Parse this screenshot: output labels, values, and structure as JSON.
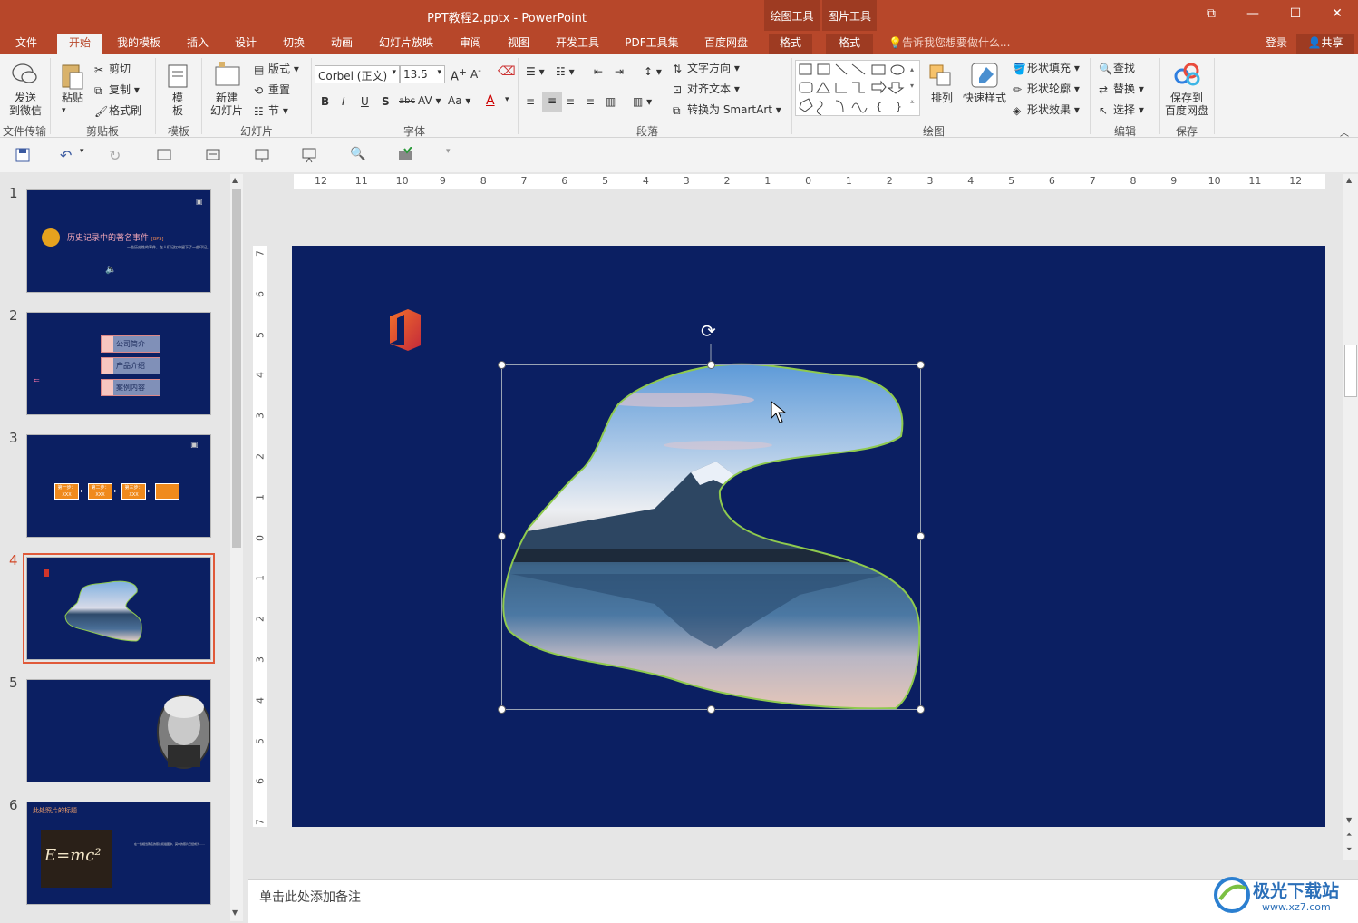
{
  "title": "PPT教程2.pptx - PowerPoint",
  "contextual": [
    {
      "group": "绘图工具",
      "tab": "格式"
    },
    {
      "group": "图片工具",
      "tab": "格式"
    }
  ],
  "window_buttons": {
    "restore_ribbon": "⧉",
    "minimize": "—",
    "maximize": "☐",
    "close": "✕"
  },
  "tabs": [
    "文件",
    "开始",
    "我的模板",
    "插入",
    "设计",
    "切换",
    "动画",
    "幻灯片放映",
    "审阅",
    "视图",
    "开发工具",
    "PDF工具集",
    "百度网盘"
  ],
  "active_tab": "开始",
  "tell_me": "告诉我您想要做什么...",
  "login": "登录",
  "share": "共享",
  "ribbon": {
    "send_wechat": "发送\n到微信",
    "file_transfer": "文件传输",
    "paste": "粘贴",
    "cut": "剪切",
    "copy": "复制",
    "format_painter": "格式刷",
    "clipboard": "剪贴板",
    "template": "模\n板",
    "template_grp": "模板",
    "new_slide": "新建\n幻灯片",
    "layout": "版式",
    "reset": "重置",
    "section": "节",
    "slides_grp": "幻灯片",
    "font_name": "Corbel (正文)",
    "font_size": "13.5",
    "font_grp": "字体",
    "text_direction": "文字方向",
    "align_text": "对齐文本",
    "smartart": "转换为 SmartArt",
    "paragraph_grp": "段落",
    "arrange": "排列",
    "quick_styles": "快速样式",
    "shape_fill": "形状填充",
    "shape_outline": "形状轮廓",
    "shape_effects": "形状效果",
    "drawing_grp": "绘图",
    "find": "查找",
    "replace": "替换",
    "select": "选择",
    "editing_grp": "编辑",
    "save_baidu": "保存到\n百度网盘",
    "save_grp": "保存"
  },
  "slides": [
    {
      "num": "1",
      "title": "历史记录中的著名事件",
      "badge": "[BPS]",
      "subtitle": "一些历史性的事件，在人们记忆中留下了一些印记。"
    },
    {
      "num": "2",
      "items": [
        "公司简介",
        "产品介绍",
        "案例内容"
      ]
    },
    {
      "num": "3",
      "steps": [
        "第一步：",
        "第二步：",
        "第三步：",
        ""
      ],
      "step_sub": "XXX"
    },
    {
      "num": "4"
    },
    {
      "num": "5"
    },
    {
      "num": "6",
      "title": "此处照片的标题",
      "formula": "E=mc²",
      "caption": "在一些相当著名的照片和插图中，其中的照片已经成为……"
    }
  ],
  "selected_slide": "4",
  "ruler_h_labels": [
    "12",
    "11",
    "10",
    "9",
    "8",
    "7",
    "6",
    "5",
    "4",
    "3",
    "2",
    "1",
    "0",
    "1",
    "2",
    "3",
    "4",
    "5",
    "6",
    "7",
    "8",
    "9",
    "10",
    "11",
    "12"
  ],
  "ruler_v_labels": [
    "7",
    "6",
    "5",
    "4",
    "3",
    "2",
    "1",
    "0",
    "1",
    "2",
    "3",
    "4",
    "5",
    "6",
    "7"
  ],
  "notes_placeholder": "单击此处添加备注",
  "watermark": "极光下载站",
  "watermark_url": "www.xz7.com",
  "colors": {
    "accent": "#b7472a",
    "slide_bg": "#0b1f62",
    "shape_outline": "#8fca4e"
  }
}
